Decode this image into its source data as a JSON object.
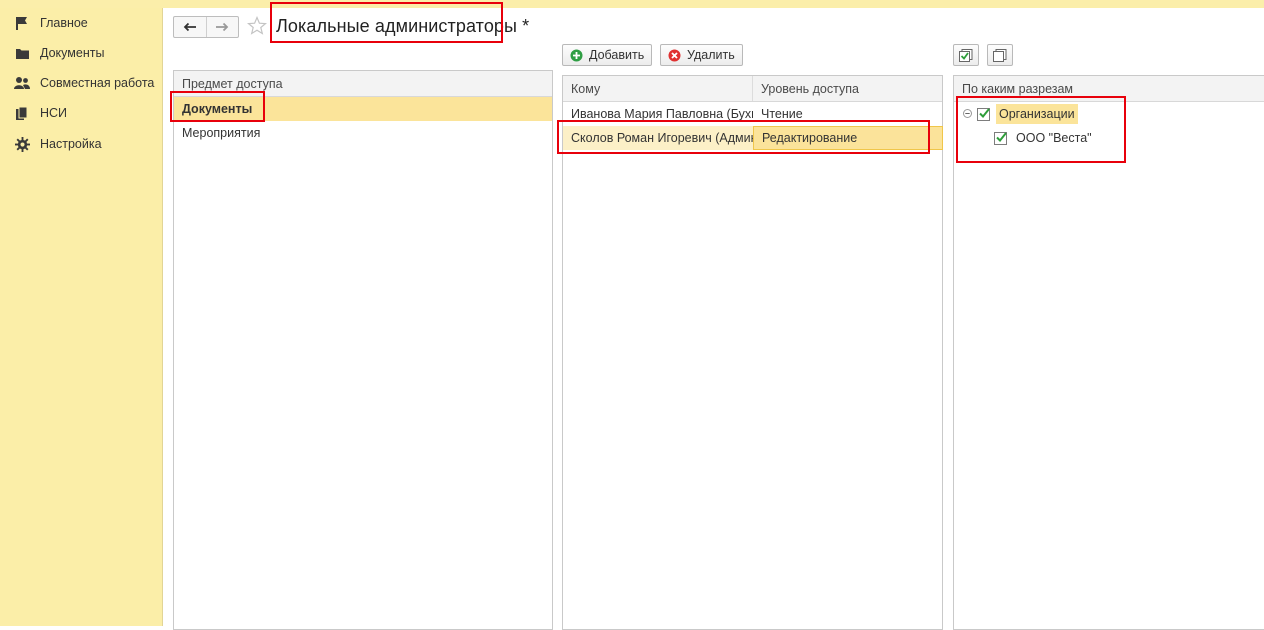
{
  "sidebar": {
    "items": [
      {
        "label": "Главное",
        "icon": "flag-icon"
      },
      {
        "label": "Документы",
        "icon": "folder-icon"
      },
      {
        "label": "Совместная работа",
        "icon": "people-icon"
      },
      {
        "label": "НСИ",
        "icon": "books-icon"
      },
      {
        "label": "Настройка",
        "icon": "gear-icon"
      }
    ]
  },
  "header": {
    "title": "Локальные администраторы *"
  },
  "subjects": {
    "column": "Предмет доступа",
    "rows": [
      "Документы",
      "Мероприятия"
    ],
    "selected_index": 0
  },
  "toolbar": {
    "add_label": "Добавить",
    "delete_label": "Удалить"
  },
  "assignees": {
    "columns": {
      "who": "Кому",
      "level": "Уровень доступа"
    },
    "rows": [
      {
        "who": "Иванова Мария Павловна (Бухгалтер)",
        "level": "Чтение"
      },
      {
        "who": "Сколов Роман Игоревич (Администратор)",
        "level": "Редактирование"
      }
    ]
  },
  "sections": {
    "column": "По каким разрезам",
    "root": {
      "label": "Организации",
      "checked": true
    },
    "children": [
      {
        "label": "ООО \"Веста\"",
        "checked": true
      }
    ]
  },
  "colors": {
    "sidebar_bg": "#fbeea8",
    "selection": "#fbe49a",
    "highlight": "#e8000b",
    "check": "#2e9e3a"
  }
}
